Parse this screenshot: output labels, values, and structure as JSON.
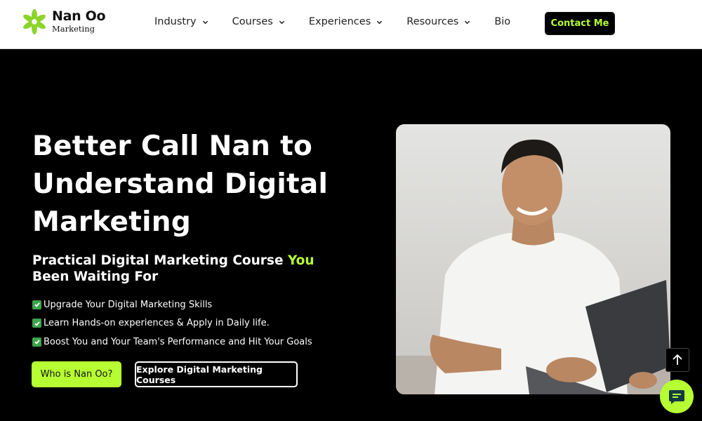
{
  "brand": {
    "name": "Nan Oo",
    "tagline": "Marketing",
    "accent_color": "#b6ff33"
  },
  "nav": {
    "items": [
      {
        "label": "Industry",
        "has_dropdown": true
      },
      {
        "label": "Courses",
        "has_dropdown": true
      },
      {
        "label": "Experiences",
        "has_dropdown": true
      },
      {
        "label": "Resources",
        "has_dropdown": true
      },
      {
        "label": "Bio",
        "has_dropdown": false
      }
    ],
    "contact_label": "Contact Me"
  },
  "hero": {
    "title": "Better Call Nan to Understand Digital Marketing",
    "subtitle_before": "Practical Digital Marketing Course ",
    "subtitle_highlight": "You",
    "subtitle_after": " Been Waiting For",
    "bullets": [
      "Upgrade Your Digital Marketing Skills",
      "Learn Hands-on experiences & Apply in Daily life.",
      "Boost You and Your Team's Performance and Hit Your Goals"
    ],
    "primary_button": "Who is Nan Oo?",
    "secondary_button": "Explore Digital Marketing Courses"
  },
  "widgets": {
    "scroll_top_icon": "arrow-up-icon",
    "chat_icon": "chat-bubble-icon"
  }
}
